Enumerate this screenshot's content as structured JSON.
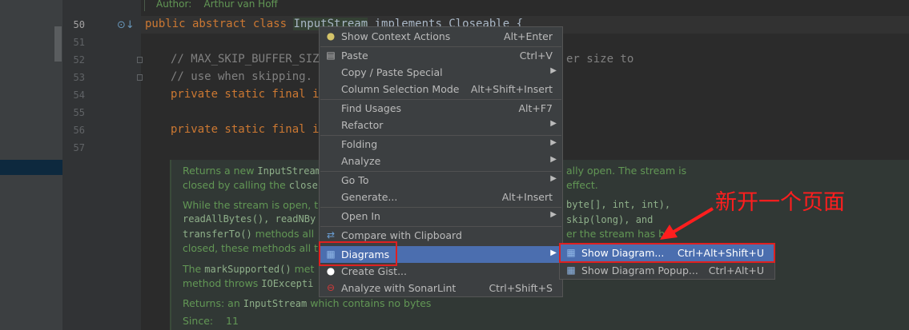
{
  "gutter": {
    "lines": [
      "50",
      "51",
      "52",
      "53",
      "54",
      "55",
      "56",
      "57"
    ]
  },
  "editor": {
    "author_label": "Author:",
    "author_name": "Arthur van Hoff",
    "l50_kw": "public abstract class ",
    "l50_name": "InputStream",
    "l50_rest": " implements Closeable {",
    "l52": "// MAX_SKIP_BUFFER_SIZE",
    "l52_tail": "er size to",
    "l53": "// use when skipping.",
    "l54": "private static final int",
    "l56": "private static final int"
  },
  "doc": {
    "p1a": "Returns a new ",
    "p1b": "InputStream",
    "p1c": "ally open. The stream is",
    "p2a": "closed by calling the ",
    "p2b": "close(",
    "p2c": "effect.",
    "p3a": "While the stream is open, th",
    "p3b": "byte[], int, int),",
    "p4a": "readAllBytes(), readNBy",
    "p4b": "skip(long), and",
    "p5a": "transferTo()",
    "p5b": " methods all",
    "p5c": "er the stream has be",
    "p6a": "closed, these methods all th",
    "p7a": "The ",
    "p7b": "markSupported()",
    "p7c": " met",
    "p8a": " method throws ",
    "p8b": "IOExcepti",
    "returns_label": "Returns: an ",
    "returns_code": "InputStream",
    "returns_rest": " which contains no bytes",
    "since_label": "Since:",
    "since_value": "11"
  },
  "context_menu": {
    "show_context_actions": {
      "label": "Show Context Actions",
      "shortcut": "Alt+Enter"
    },
    "paste": {
      "label": "Paste",
      "shortcut": "Ctrl+V"
    },
    "copy_paste_special": {
      "label": "Copy / Paste Special",
      "arrow": "▶"
    },
    "column_selection_mode": {
      "label": "Column Selection Mode",
      "shortcut": "Alt+Shift+Insert"
    },
    "find_usages": {
      "label": "Find Usages",
      "shortcut": "Alt+F7"
    },
    "refactor": {
      "label": "Refactor",
      "arrow": "▶"
    },
    "folding": {
      "label": "Folding",
      "arrow": "▶"
    },
    "analyze": {
      "label": "Analyze",
      "arrow": "▶"
    },
    "go_to": {
      "label": "Go To",
      "arrow": "▶"
    },
    "generate": {
      "label": "Generate...",
      "shortcut": "Alt+Insert"
    },
    "open_in": {
      "label": "Open In",
      "arrow": "▶"
    },
    "compare_clipboard": {
      "label": "Compare with Clipboard"
    },
    "diagrams": {
      "label": "Diagrams",
      "arrow": "▶"
    },
    "create_gist": {
      "label": "Create Gist..."
    },
    "analyze_sonarlint": {
      "label": "Analyze with SonarLint",
      "shortcut": "Ctrl+Shift+S"
    }
  },
  "submenu": {
    "show_diagram": {
      "label": "Show Diagram...",
      "shortcut": "Ctrl+Alt+Shift+U"
    },
    "show_diagram_popup": {
      "label": "Show Diagram Popup...",
      "shortcut": "Ctrl+Alt+U"
    }
  },
  "annotation": {
    "text": "新开一个页面"
  },
  "colors": {
    "menu_bg": "#3c3f41",
    "selection": "#4b6eaf",
    "annotation_red": "#ff1e1e",
    "editor_bg": "#2b2b2b"
  }
}
